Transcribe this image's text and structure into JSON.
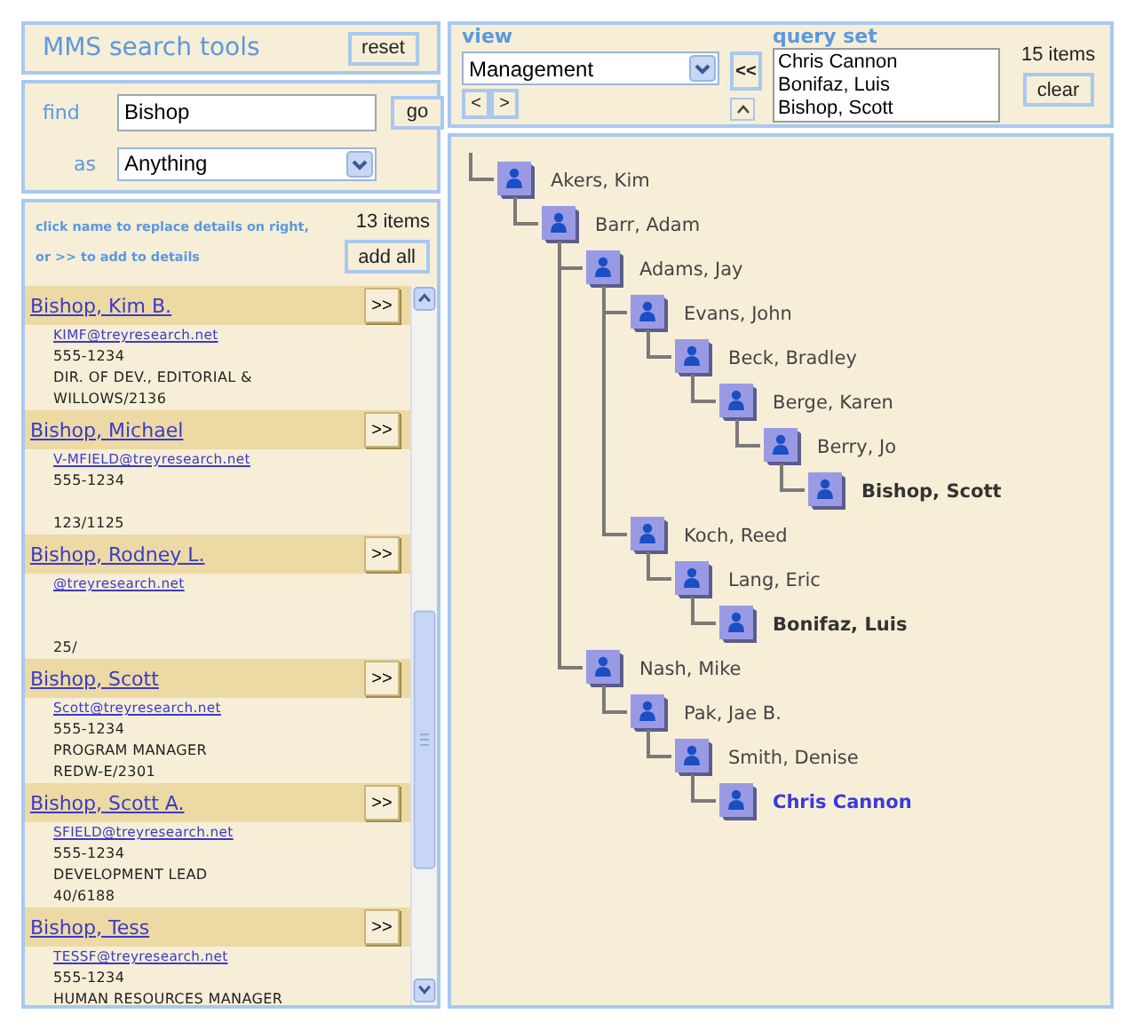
{
  "header": {
    "title": "MMS search tools",
    "reset_button": "reset"
  },
  "search": {
    "find_label": "find",
    "query": "Bishop",
    "go_button": "go",
    "as_label": "as",
    "as_value": "Anything"
  },
  "results": {
    "hint": "click name to replace details on right, or >> to add to details",
    "count": "13 items",
    "add_all_button": "add all",
    "items": [
      {
        "name": "Bishop, Kim B.",
        "add_button": ">>",
        "email": "KIMF@treyresearch.net",
        "phone": "555-1234",
        "title": "DIR. OF DEV., EDITORIAL &",
        "location": "WILLOWS/2136"
      },
      {
        "name": "Bishop, Michael",
        "add_button": ">>",
        "email": "V-MFIELD@treyresearch.net",
        "phone": "555-1234",
        "location": "123/1125"
      },
      {
        "name": "Bishop, Rodney L.",
        "add_button": ">>",
        "email": "@treyresearch.net",
        "location": "25/"
      },
      {
        "name": "Bishop, Scott",
        "add_button": ">>",
        "email": "Scott@treyresearch.net",
        "phone": "555-1234",
        "title": "PROGRAM MANAGER",
        "location": "REDW-E/2301"
      },
      {
        "name": "Bishop, Scott A.",
        "add_button": ">>",
        "email": "SFIELD@treyresearch.net",
        "phone": "555-1234",
        "title": "DEVELOPMENT LEAD",
        "location": "40/6188"
      },
      {
        "name": "Bishop, Tess",
        "add_button": ">>",
        "email": "TESSF@treyresearch.net",
        "phone": "555-1234",
        "title": "HUMAN RESOURCES MANAGER"
      }
    ]
  },
  "view": {
    "label": "view",
    "value": "Management",
    "prev_button": "<",
    "next_button": ">"
  },
  "add_to_set_button": "<<",
  "query_set": {
    "label": "query set",
    "count": "15 items",
    "clear_button": "clear",
    "items": [
      {
        "name": "Chris Cannon",
        "selected": false
      },
      {
        "name": "Bonifaz, Luis",
        "selected": false
      },
      {
        "name": "Bishop, Scott",
        "selected": false
      }
    ]
  },
  "tree": [
    {
      "name": "Akers, Kim",
      "in_query_set": false,
      "selected": false,
      "children": [
        {
          "name": "Barr, Adam",
          "in_query_set": false,
          "selected": false,
          "children": [
            {
              "name": "Adams, Jay",
              "in_query_set": false,
              "selected": false,
              "children": [
                {
                  "name": "Evans, John",
                  "in_query_set": false,
                  "selected": false,
                  "children": [
                    {
                      "name": "Beck, Bradley",
                      "in_query_set": false,
                      "selected": false,
                      "children": [
                        {
                          "name": "Berge, Karen",
                          "in_query_set": false,
                          "selected": false,
                          "children": [
                            {
                              "name": "Berry, Jo",
                              "in_query_set": false,
                              "selected": false,
                              "children": [
                                {
                                  "name": "Bishop, Scott",
                                  "in_query_set": true,
                                  "selected": false
                                }
                              ]
                            }
                          ]
                        }
                      ]
                    }
                  ]
                },
                {
                  "name": "Koch, Reed",
                  "in_query_set": false,
                  "selected": false,
                  "children": [
                    {
                      "name": "Lang, Eric",
                      "in_query_set": false,
                      "selected": false,
                      "children": [
                        {
                          "name": "Bonifaz, Luis",
                          "in_query_set": true,
                          "selected": false
                        }
                      ]
                    }
                  ]
                }
              ]
            },
            {
              "name": "Nash, Mike",
              "in_query_set": false,
              "selected": false,
              "children": [
                {
                  "name": "Pak, Jae B.",
                  "in_query_set": false,
                  "selected": false,
                  "children": [
                    {
                      "name": "Smith, Denise",
                      "in_query_set": false,
                      "selected": false,
                      "children": [
                        {
                          "name": "Chris Cannon",
                          "in_query_set": true,
                          "selected": true
                        }
                      ]
                    }
                  ]
                }
              ]
            }
          ]
        }
      ]
    }
  ]
}
